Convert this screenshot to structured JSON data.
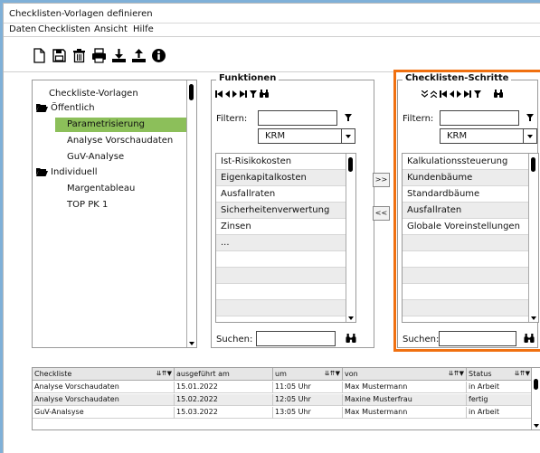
{
  "window": {
    "title": "Checklisten-Vorlagen definieren"
  },
  "menu": [
    "Daten",
    "Checklisten",
    "Ansicht",
    "Hilfe"
  ],
  "toolbar_icons": [
    "new-document-icon",
    "save-icon",
    "delete-icon",
    "print-icon",
    "download-icon",
    "upload-icon",
    "info-icon"
  ],
  "tree": {
    "root": "Checkliste-Vorlagen",
    "groups": [
      {
        "label": "Öffentlich",
        "items": [
          "Parametrisierung",
          "Analyse Vorschaudaten",
          "GuV-Analyse"
        ]
      },
      {
        "label": "Individuell",
        "items": [
          "Margentableau",
          "TOP PK 1"
        ]
      }
    ],
    "selected": "Parametrisierung",
    "selected_color": "#8cbf5a"
  },
  "funktionen": {
    "title": "Funktionen",
    "filter_label": "Filtern:",
    "filter_value": "",
    "dropdown_value": "KRM",
    "items": [
      "Ist-Risikokosten",
      "Eigenkapitalkosten",
      "Ausfallraten",
      "Sicherheitenverwertung",
      "Zinsen",
      "..."
    ],
    "search_label": "Suchen:",
    "search_value": ""
  },
  "move_buttons": {
    "add": ">>",
    "remove": "<<"
  },
  "schritte": {
    "title": "Checklisten-Schritte",
    "filter_label": "Filtern:",
    "filter_value": "",
    "dropdown_value": "KRM",
    "items": [
      "Kalkulationssteuerung",
      "Kundenbäume",
      "Standardbäume",
      "Ausfallraten",
      "Globale Voreinstellungen"
    ],
    "search_label": "Suchen:",
    "search_value": "",
    "highlight_color": "#f07010"
  },
  "history_table": {
    "columns": [
      "Checkliste",
      "ausgeführt am",
      "um",
      "von",
      "Status"
    ],
    "rows": [
      [
        "Analyse Vorschaudaten",
        "15.01.2022",
        "11:05 Uhr",
        "Max Mustermann",
        "in Arbeit"
      ],
      [
        "Analyse Vorschaudaten",
        "15.02.2022",
        "12:05 Uhr",
        "Maxine Musterfrau",
        "fertig"
      ],
      [
        "GuV-Analsyse",
        "15.03.2022",
        "13:05 Uhr",
        "Max Mustermann",
        "in Arbeit"
      ]
    ]
  }
}
